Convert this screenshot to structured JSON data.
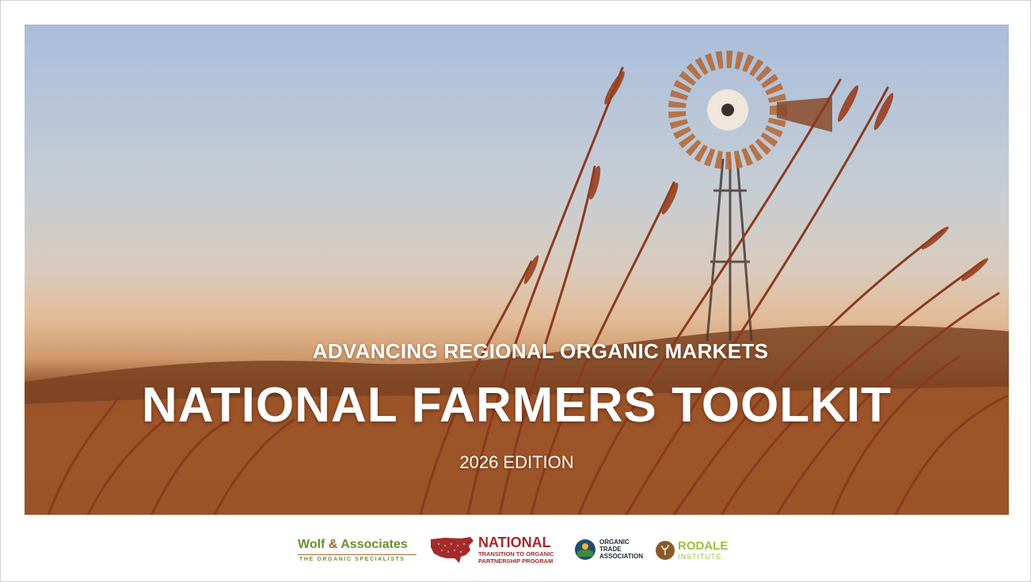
{
  "slide": {
    "kicker": "ADVANCING REGIONAL ORGANIC MARKETS",
    "title": "NATIONAL FARMERS TOOLKIT",
    "edition": "2026 EDITION"
  },
  "logos": {
    "wolf": {
      "name": "Wolf",
      "amp": "&",
      "name2": "Associates",
      "tagline": "THE ORGANIC SPECIALISTS"
    },
    "national": {
      "big": "NATIONAL",
      "line1": "TRANSITION TO ORGANIC",
      "line2": "PARTNERSHIP PROGRAM"
    },
    "ota": {
      "line1": "ORGANIC",
      "line2": "TRADE",
      "line3": "ASSOCIATION"
    },
    "rodale": {
      "line1": "RODALE",
      "line2": "INSTITUTE."
    }
  },
  "colors": {
    "sky_top": "#a9bddb",
    "horizon": "#e2bb98",
    "field": "#9a5a34",
    "grass": "#8b3a1e",
    "wolf_green": "#6a8f2d",
    "national_red": "#a52a2a",
    "rodale_green": "#9bbf3a"
  },
  "icons": [
    "windmill-image",
    "prairie-grass-image",
    "usa-map-icon",
    "ota-globe-icon",
    "rodale-seal-icon"
  ]
}
